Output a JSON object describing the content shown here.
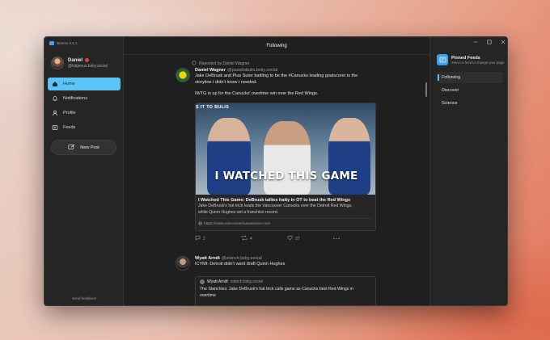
{
  "app": {
    "title": "Breeze 0.5.1"
  },
  "colors": {
    "accent": "#5bc3f7",
    "danger": "#e0403a"
  },
  "sidebar": {
    "profile": {
      "name": "Daniel",
      "handle": "@kidjenus.bsky.social"
    },
    "nav": [
      {
        "label": "Home",
        "icon": "home-icon",
        "active": true
      },
      {
        "label": "Notifications",
        "icon": "bell-icon"
      },
      {
        "label": "Profile",
        "icon": "person-icon"
      },
      {
        "label": "Feeds",
        "icon": "feeds-icon"
      }
    ],
    "new_post": "New Post",
    "send_feedback": "Send feedback"
  },
  "main": {
    "header": "Following",
    "post1": {
      "repost": "Reposted by Daniel Wagner",
      "author": "Daniel Wagner",
      "handle": "@passitobulis.bsky.social",
      "text1": "Jake DeBrusk and Pius Suter battling to be the #Canucks leading goalscorer is the",
      "text2": "storyline I didn't know I needed.",
      "text3": "IWTG is up for the Canucks' overtime win over the Red Wings.",
      "embed": {
        "image_strip": "S IT TO BULIS",
        "image_headline": "I WATCHED THIS GAME",
        "title": "I Watched This Game: DeBrusk tallies hatty in OT to beat the Red Wings",
        "desc1": "Jake DeBrusk's hat trick leads the Vancouver Canucks over the Detroit Red Wings,",
        "desc2": "while Quinn Hughes set a franchise record.",
        "link": "https://www.vancouverisawesome.com"
      },
      "actions": {
        "replies": "2",
        "reposts": "4",
        "likes": "37"
      }
    },
    "post2": {
      "author": "Wyatt Arndt",
      "handle": "@stanch.bsky.social",
      "text": "ICYMI: Detroit didn't want draft Quinn Hughes",
      "quote": {
        "author": "Wyatt Arndt",
        "handle": "stanch.bsky.social",
        "text1": "The Stanchies: Jake DeBrusk's hat trick calls game as Canucks best Red Wings in",
        "text2": "overtime"
      }
    }
  },
  "right_panel": {
    "title": "Pinned Feeds",
    "subtitle": "Select a feed to change your page",
    "feeds": [
      {
        "label": "Following",
        "active": true
      },
      {
        "label": "Discover"
      },
      {
        "label": "Science"
      }
    ]
  }
}
